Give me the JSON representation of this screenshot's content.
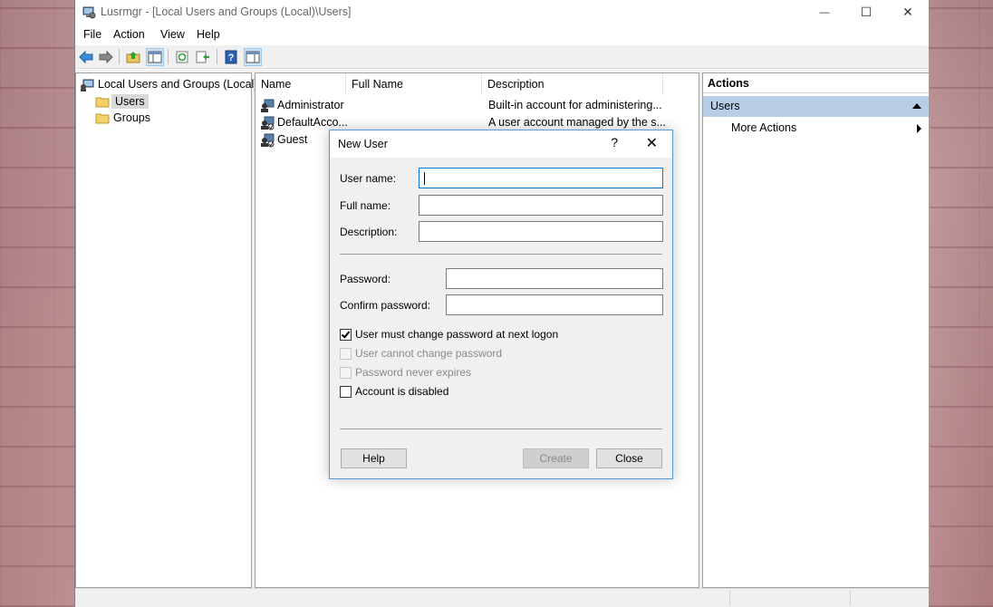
{
  "window": {
    "title": "Lusrmgr - [Local Users and Groups (Local)\\Users]",
    "controls": {
      "minimize": "—",
      "maximize": "☐",
      "close": "✕"
    }
  },
  "menu": {
    "items": [
      "File",
      "Action",
      "View",
      "Help"
    ]
  },
  "toolbar": {
    "icons": [
      "back-arrow-icon",
      "forward-arrow-icon",
      "up-folder-icon",
      "show-hide-tree-icon",
      "refresh-icon",
      "export-list-icon",
      "help-icon",
      "show-hide-action-pane-icon"
    ]
  },
  "tree": {
    "root": "Local Users and Groups (Local)",
    "children": [
      {
        "label": "Users",
        "selected": true
      },
      {
        "label": "Groups",
        "selected": false
      }
    ]
  },
  "list": {
    "columns": [
      "Name",
      "Full Name",
      "Description"
    ],
    "rows": [
      {
        "name": "Administrator",
        "full_name": "",
        "description": "Built-in account for administering..."
      },
      {
        "name": "DefaultAcco...",
        "full_name": "",
        "description": "A user account managed by the s..."
      },
      {
        "name": "Guest",
        "full_name": "",
        "description": ""
      }
    ]
  },
  "actions": {
    "title": "Actions",
    "section": "Users",
    "more": "More Actions"
  },
  "dialog": {
    "title": "New User",
    "help_glyph": "?",
    "close_glyph": "✕",
    "fields": {
      "user_name": {
        "label": "User name:",
        "value": ""
      },
      "full_name": {
        "label": "Full name:",
        "value": ""
      },
      "description": {
        "label": "Description:",
        "value": ""
      },
      "password": {
        "label": "Password:",
        "value": ""
      },
      "confirm_password": {
        "label": "Confirm password:",
        "value": ""
      }
    },
    "checkboxes": [
      {
        "label": "User must change password at next logon",
        "checked": true,
        "enabled": true
      },
      {
        "label": "User cannot change password",
        "checked": false,
        "enabled": false
      },
      {
        "label": "Password never expires",
        "checked": false,
        "enabled": false
      },
      {
        "label": "Account is disabled",
        "checked": false,
        "enabled": true
      }
    ],
    "buttons": {
      "help": "Help",
      "create": "Create",
      "close": "Close"
    }
  }
}
